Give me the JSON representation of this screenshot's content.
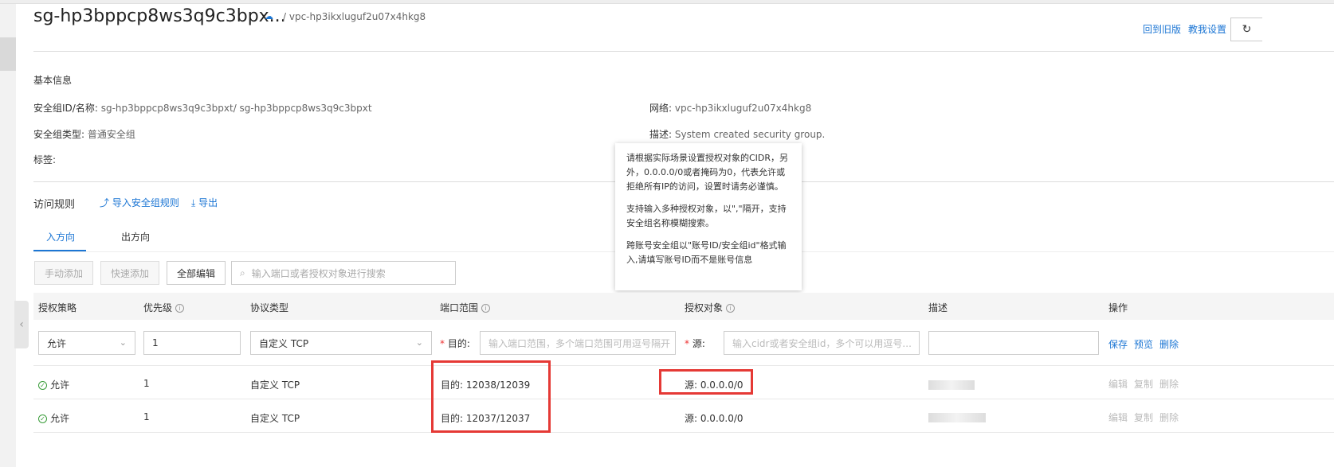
{
  "header": {
    "title": "sg-hp3bppcp8ws3q9c3bpx...",
    "vpc_crumb": "/ vpc-hp3ikxluguf2u07x4hkg8",
    "links": [
      "回到旧版",
      "教我设置"
    ]
  },
  "basic_info": {
    "section_title": "基本信息",
    "sg_id_label": "安全组ID/名称:",
    "sg_id_value": "sg-hp3bppcp8ws3q9c3bpxt/ sg-hp3bppcp8ws3q9c3bpxt",
    "sg_type_label": "安全组类型:",
    "sg_type_value": "普通安全组",
    "tags_label": "标签:",
    "network_label": "网络:",
    "network_value": "vpc-hp3ikxluguf2u07x4hkg8",
    "desc_label": "描述:",
    "desc_value": "System created security group."
  },
  "tooltip": {
    "p1": "请根据实际场景设置授权对象的CIDR，另外，0.0.0.0/0或者掩码为0，代表允许或拒绝所有IP的访问，设置时请务必谨慎。",
    "p2": "支持输入多种授权对象，以\",\"隔开，支持安全组名称模糊搜索。",
    "p3": "跨账号安全组以\"账号ID/安全组id\"格式输入,请填写账号ID而不是账号信息"
  },
  "rules": {
    "section_title": "访问规则",
    "import_link": "导入安全组规则",
    "export_link": "导出",
    "tabs": [
      "入方向",
      "出方向"
    ],
    "buttons": {
      "manual_add": "手动添加",
      "quick_add": "快速添加",
      "edit_all": "全部编辑"
    },
    "search_placeholder": "输入端口或者授权对象进行搜索",
    "columns": [
      "授权策略",
      "优先级",
      "协议类型",
      "端口范围",
      "授权对象",
      "描述",
      "操作"
    ],
    "edit_row": {
      "policy": "允许",
      "priority": "1",
      "protocol": "自定义 TCP",
      "dest_label": "目的:",
      "port_placeholder": "输入端口范围，多个端口范围可用逗号隔开",
      "source_label": "源:",
      "source_placeholder": "输入cidr或者安全组id，多个可以用逗号...",
      "actions": [
        "保存",
        "预览",
        "删除"
      ]
    },
    "rows": [
      {
        "policy": "允许",
        "priority": "1",
        "protocol": "自定义 TCP",
        "port": "目的: 12038/12039",
        "source": "源: 0.0.0.0/0",
        "actions": [
          "编辑",
          "复制",
          "删除"
        ]
      },
      {
        "policy": "允许",
        "priority": "1",
        "protocol": "自定义 TCP",
        "port": "目的: 12037/12037",
        "source": "源: 0.0.0.0/0",
        "actions": [
          "编辑",
          "复制",
          "删除"
        ]
      }
    ]
  },
  "colors": {
    "accent": "#1c76d4",
    "highlight": "#e53935",
    "ok": "#3a9d3a"
  }
}
